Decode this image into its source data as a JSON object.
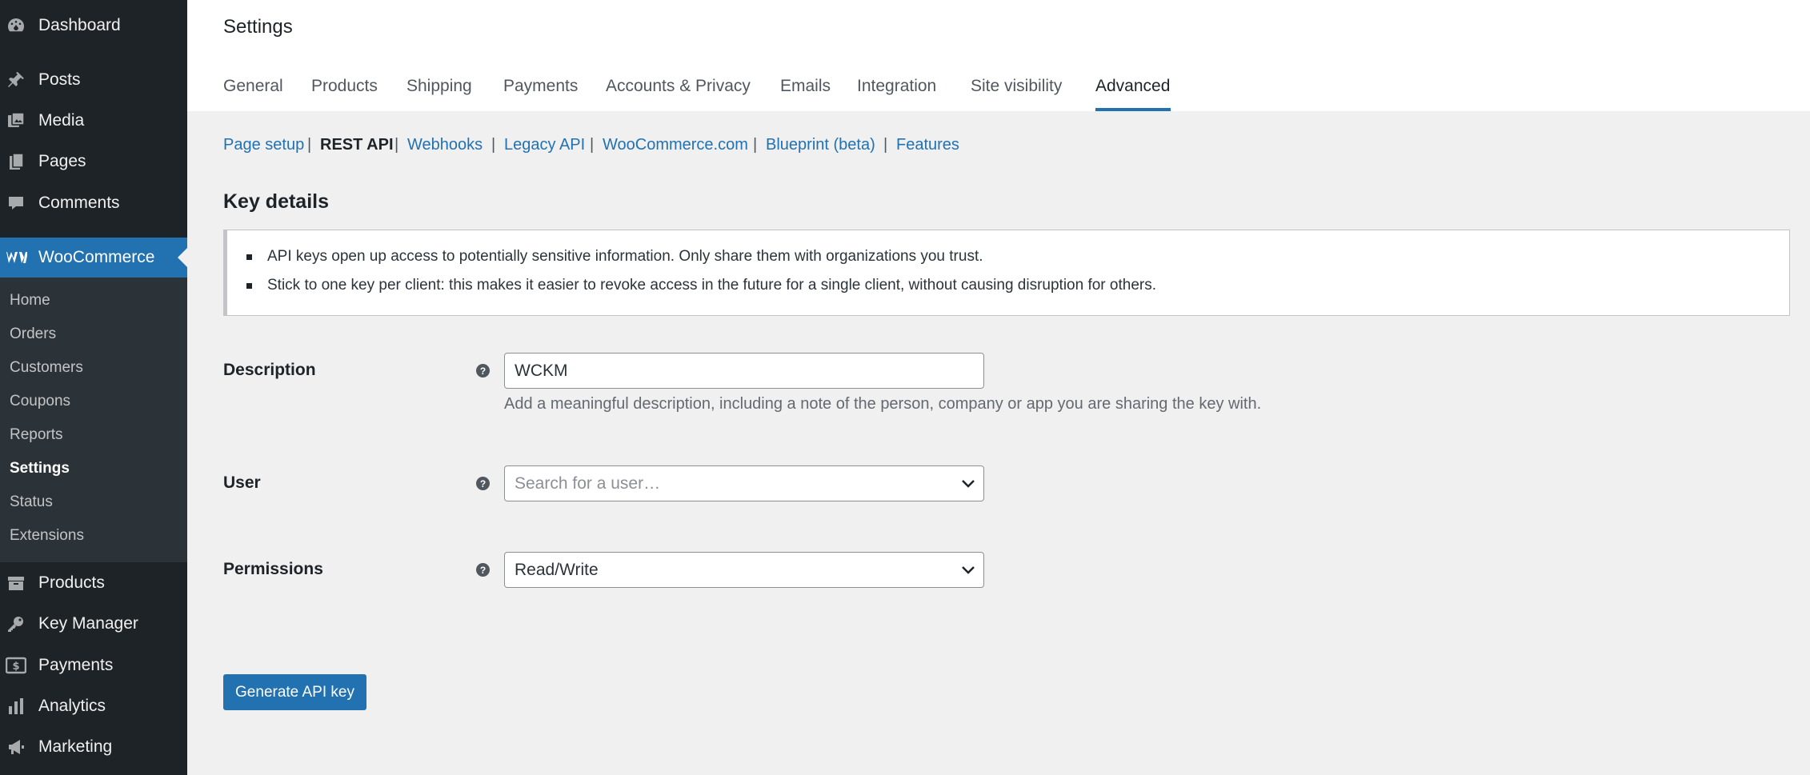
{
  "sidebar": {
    "dashboard": "Dashboard",
    "posts": "Posts",
    "media": "Media",
    "pages": "Pages",
    "comments": "Comments",
    "woocommerce": "WooCommerce",
    "submenu": [
      "Home",
      "Orders",
      "Customers",
      "Coupons",
      "Reports",
      "Settings",
      "Status",
      "Extensions"
    ],
    "products": "Products",
    "key_manager": "Key Manager",
    "payments": "Payments",
    "analytics": "Analytics",
    "marketing": "Marketing"
  },
  "header": {
    "title": "Settings",
    "tabs": [
      "General",
      "Products",
      "Shipping",
      "Payments",
      "Accounts & Privacy",
      "Emails",
      "Integration",
      "Site visibility",
      "Advanced"
    ]
  },
  "subsub": [
    "Page setup",
    "REST API",
    "Webhooks",
    "Legacy API",
    "WooCommerce.com",
    "Blueprint (beta)",
    "Features"
  ],
  "section_title": "Key details",
  "notice": [
    "API keys open up access to potentially sensitive information. Only share them with organizations you trust.",
    "Stick to one key per client: this makes it easier to revoke access in the future for a single client, without causing disruption for others."
  ],
  "form": {
    "description_label": "Description",
    "description_value": "WCKM",
    "description_help": "Add a meaningful description, including a note of the person, company or app you are sharing the key with.",
    "user_label": "User",
    "user_placeholder": "Search for a user…",
    "permissions_label": "Permissions",
    "permissions_value": "Read/Write",
    "help_glyph": "?"
  },
  "generate_button": "Generate API key",
  "colors": {
    "accent": "#2271b1",
    "sidebar": "#1d2327",
    "background": "#f0f0f1"
  }
}
